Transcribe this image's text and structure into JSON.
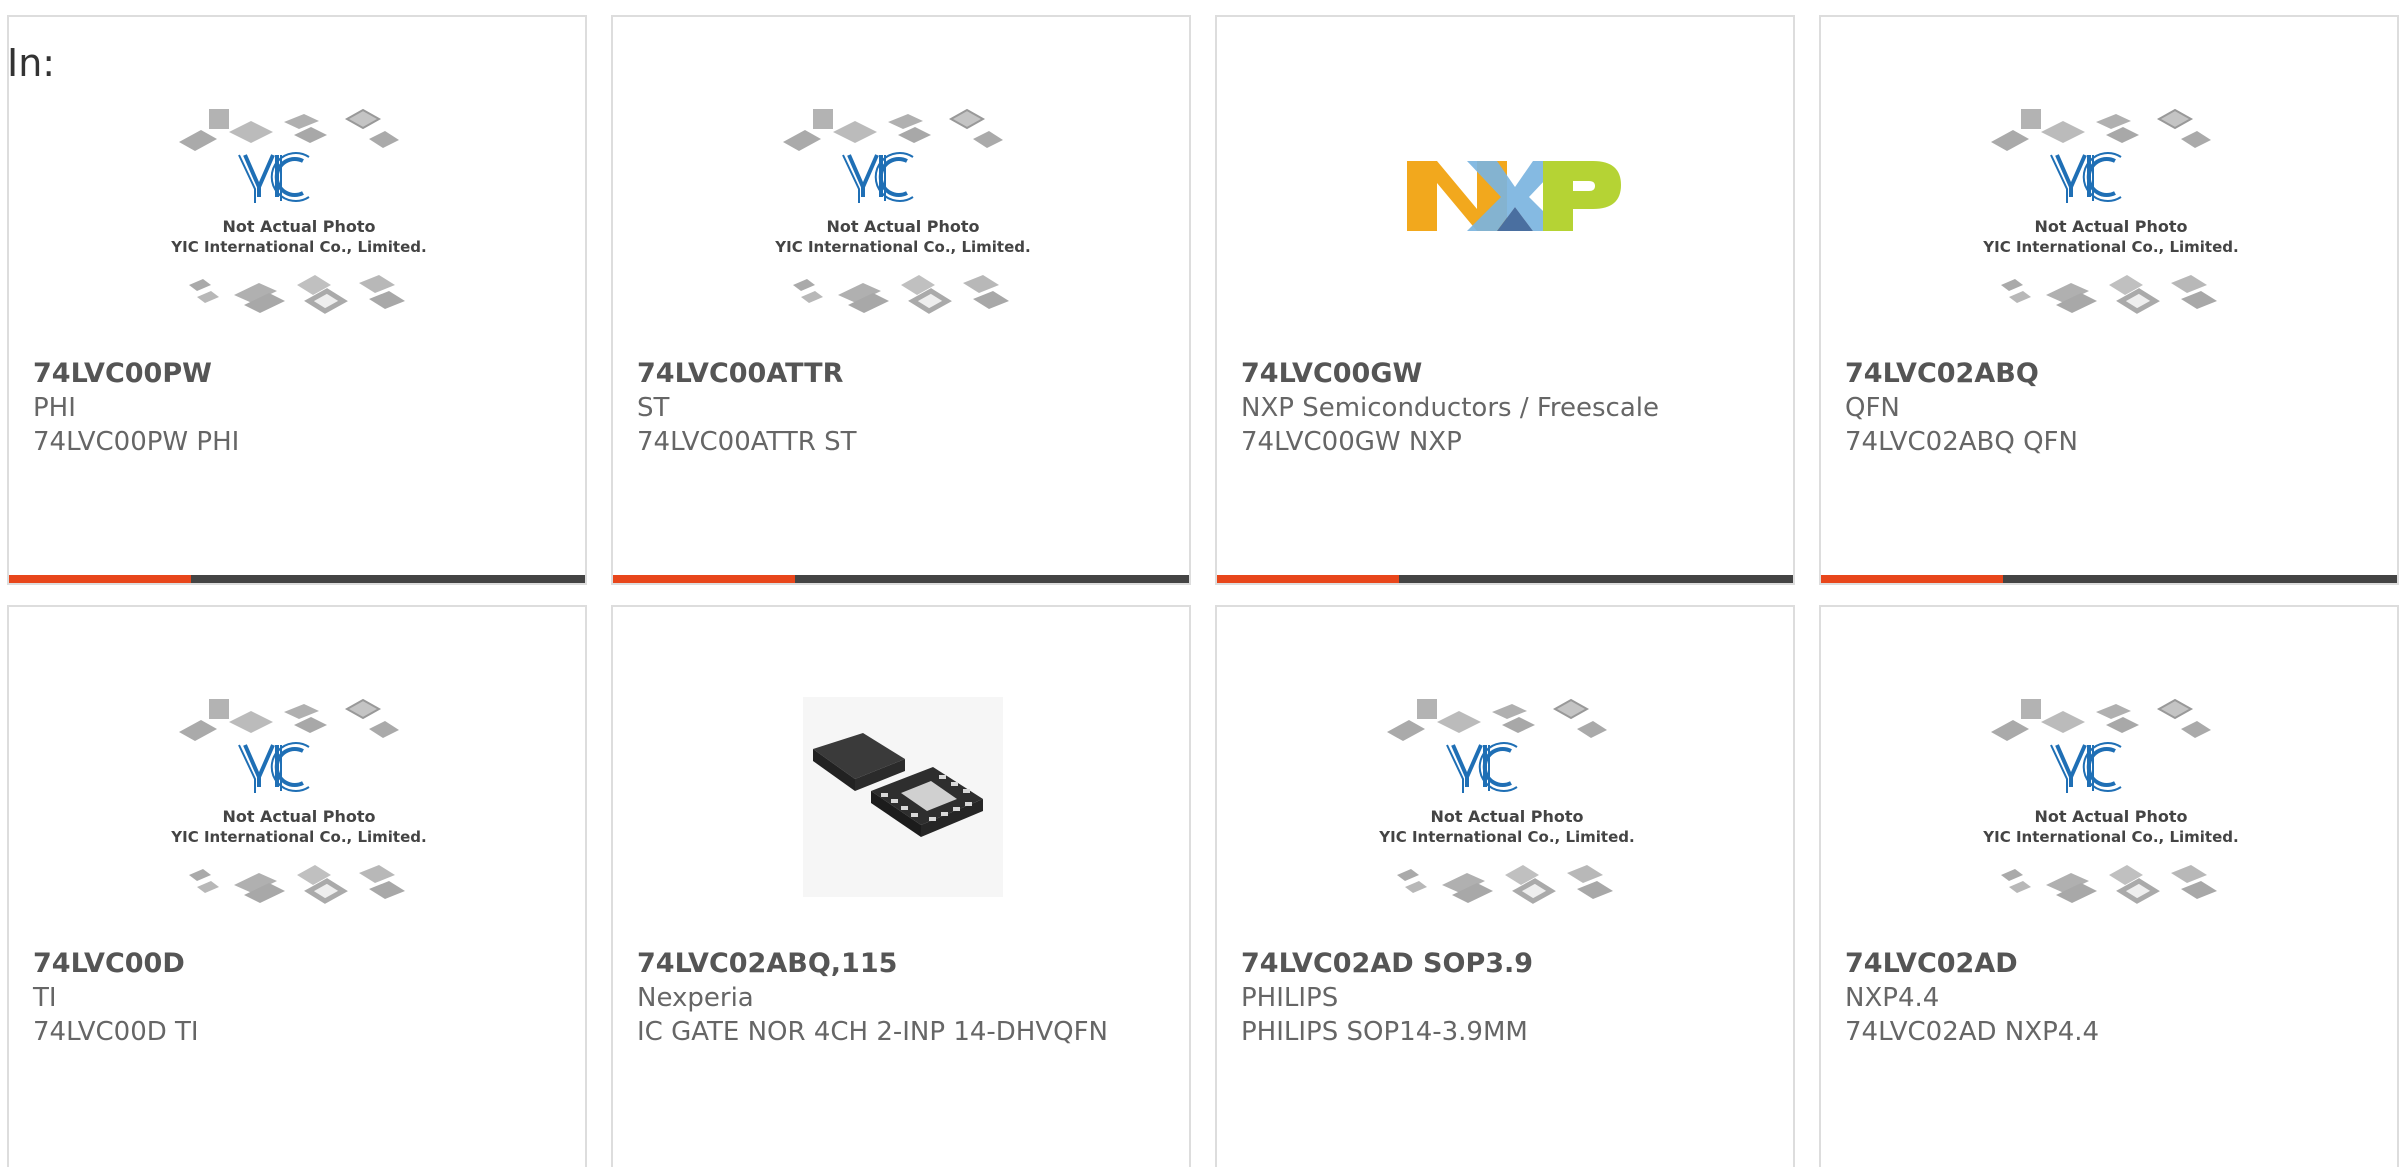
{
  "heading": "In:",
  "placeholder": {
    "line1": "Not Actual Photo",
    "line2": "YIC International Co., Limited."
  },
  "colors": {
    "accent": "#e8461b",
    "bar": "#444444",
    "logo_blue": "#1f6fb5",
    "nxp_orange": "#f2a81d",
    "nxp_blue": "#7bb4e0",
    "nxp_green": "#b5d334"
  },
  "products": [
    {
      "part_number": "74LVC00PW",
      "manufacturer": "PHI",
      "description": "74LVC00PW PHI",
      "image": "yic-placeholder-icon"
    },
    {
      "part_number": "74LVC00ATTR",
      "manufacturer": "ST",
      "description": "74LVC00ATTR ST",
      "image": "yic-placeholder-icon"
    },
    {
      "part_number": "74LVC00GW",
      "manufacturer": "NXP Semiconductors / Freescale",
      "description": "74LVC00GW NXP",
      "image": "nxp-logo-icon"
    },
    {
      "part_number": "74LVC02ABQ",
      "manufacturer": "QFN",
      "description": "74LVC02ABQ QFN",
      "image": "yic-placeholder-icon"
    },
    {
      "part_number": "74LVC00D",
      "manufacturer": "TI",
      "description": "74LVC00D TI",
      "image": "yic-placeholder-icon"
    },
    {
      "part_number": "74LVC02ABQ,115",
      "manufacturer": "Nexperia",
      "description": "IC GATE NOR 4CH 2-INP 14-DHVQFN",
      "image": "qfn-chip-photo-icon"
    },
    {
      "part_number": "74LVC02AD SOP3.9",
      "manufacturer": "PHILIPS",
      "description": "PHILIPS SOP14-3.9MM",
      "image": "yic-placeholder-icon"
    },
    {
      "part_number": "74LVC02AD",
      "manufacturer": "NXP4.4",
      "description": "74LVC02AD NXP4.4",
      "image": "yic-placeholder-icon"
    }
  ]
}
